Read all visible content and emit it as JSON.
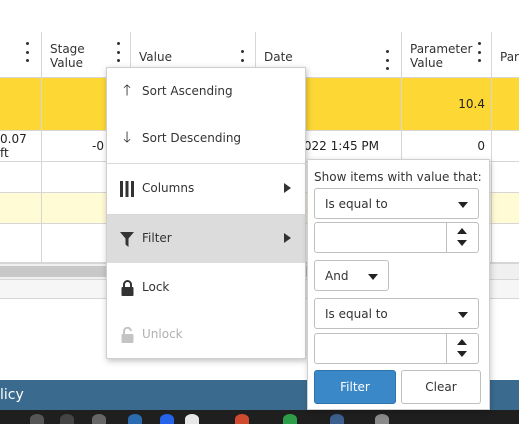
{
  "grid": {
    "columns": [
      {
        "label": "",
        "key": "col0"
      },
      {
        "label": "Stage Value",
        "key": "stage"
      },
      {
        "label": "Value",
        "key": "value"
      },
      {
        "label": "Date",
        "key": "date"
      },
      {
        "label": "Parameter Value",
        "key": "param"
      },
      {
        "label": "Par",
        "key": "par"
      }
    ],
    "header": {
      "stage_line1": "Stage",
      "stage_line2": "Value",
      "value": "Value",
      "date": "Date",
      "param_line1": "Parameter",
      "param_line2": "Value",
      "par": "Par"
    },
    "rows": [
      {
        "col0": "",
        "stage": "",
        "value": "",
        "date": "",
        "param": "10.4",
        "highlight": "#fdd835"
      },
      {
        "col0": "0.07 ft",
        "stage": "-0",
        "value": "",
        "date": "2022 1:45 PM",
        "param": "0",
        "highlight": "#ffffff"
      },
      {
        "col0": "",
        "stage": "",
        "value": "",
        "date": "",
        "param": "",
        "highlight": "#ffffff"
      },
      {
        "col0": "",
        "stage": "",
        "value": "",
        "date": "",
        "param": "",
        "highlight": "#fffbd5"
      },
      {
        "col0": "",
        "stage": "",
        "value": "",
        "date": "",
        "param": "",
        "highlight": "#ffffff"
      }
    ]
  },
  "footer": {
    "text": "licy",
    "color": "#3a6b8e"
  },
  "column_menu": {
    "items": [
      {
        "label": "Sort Ascending",
        "icon": "arrow-up-icon"
      },
      {
        "label": "Sort Descending",
        "icon": "arrow-down-icon"
      },
      {
        "label": "Columns",
        "icon": "columns-icon",
        "submenu": true
      },
      {
        "label": "Filter",
        "icon": "filter-icon",
        "submenu": true,
        "active": true
      },
      {
        "label": "Lock",
        "icon": "lock-icon"
      },
      {
        "label": "Unlock",
        "icon": "unlock-icon",
        "disabled": true
      }
    ]
  },
  "filter_panel": {
    "title": "Show items with value that:",
    "operator1": "Is equal to",
    "value1": "",
    "logic": "And",
    "operator2": "Is equal to",
    "value2": "",
    "filter_label": "Filter",
    "clear_label": "Clear",
    "primary_color": "#3b88c8"
  }
}
